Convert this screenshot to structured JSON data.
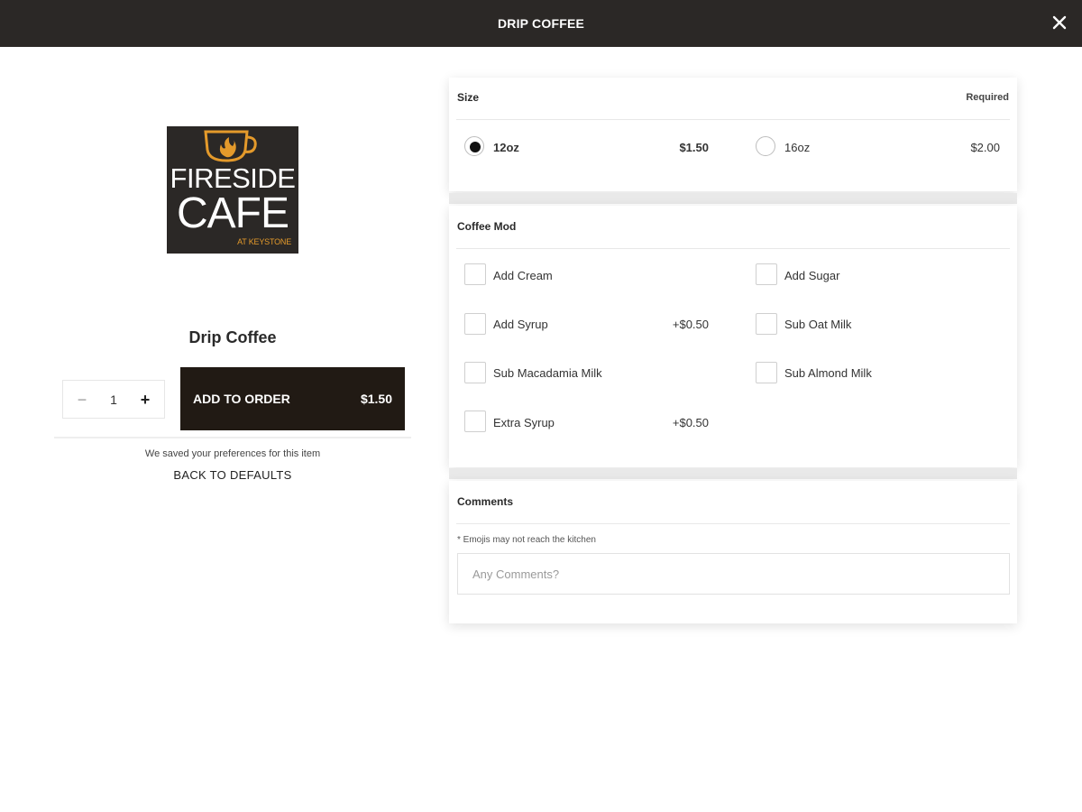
{
  "header": {
    "title": "DRIP COFFEE",
    "close_icon": "close-icon"
  },
  "logo": {
    "line1": "FIRESIDE",
    "line2": "CAFE",
    "line3": "AT KEYSTONE",
    "accent_color": "#e49a2b",
    "icon": "coffee-cup-flame-icon"
  },
  "item": {
    "name": "Drip Coffee",
    "quantity": "1",
    "minus": "−",
    "plus": "+",
    "add_label": "ADD TO ORDER",
    "add_price": "$1.50",
    "saved_note": "We saved your preferences for this item",
    "back_to_defaults": "BACK TO DEFAULTS"
  },
  "size": {
    "title": "Size",
    "required": "Required",
    "options": [
      {
        "label": "12oz",
        "price": "$1.50",
        "selected": true
      },
      {
        "label": "16oz",
        "price": "$2.00",
        "selected": false
      }
    ]
  },
  "coffee_mod": {
    "title": "Coffee Mod",
    "options": [
      {
        "label": "Add Cream",
        "price": ""
      },
      {
        "label": "Add Sugar",
        "price": ""
      },
      {
        "label": "Add Syrup",
        "price": "+$0.50"
      },
      {
        "label": "Sub Oat Milk",
        "price": ""
      },
      {
        "label": "Sub Macadamia Milk",
        "price": ""
      },
      {
        "label": "Sub Almond Milk",
        "price": ""
      },
      {
        "label": "Extra Syrup",
        "price": "+$0.50"
      }
    ]
  },
  "comments": {
    "title": "Comments",
    "note": "* Emojis may not reach the kitchen",
    "placeholder": "Any Comments?",
    "value": ""
  },
  "colors": {
    "header_bg": "#2b2826",
    "button_bg": "#211a14",
    "logo_bg": "#2b2826"
  }
}
